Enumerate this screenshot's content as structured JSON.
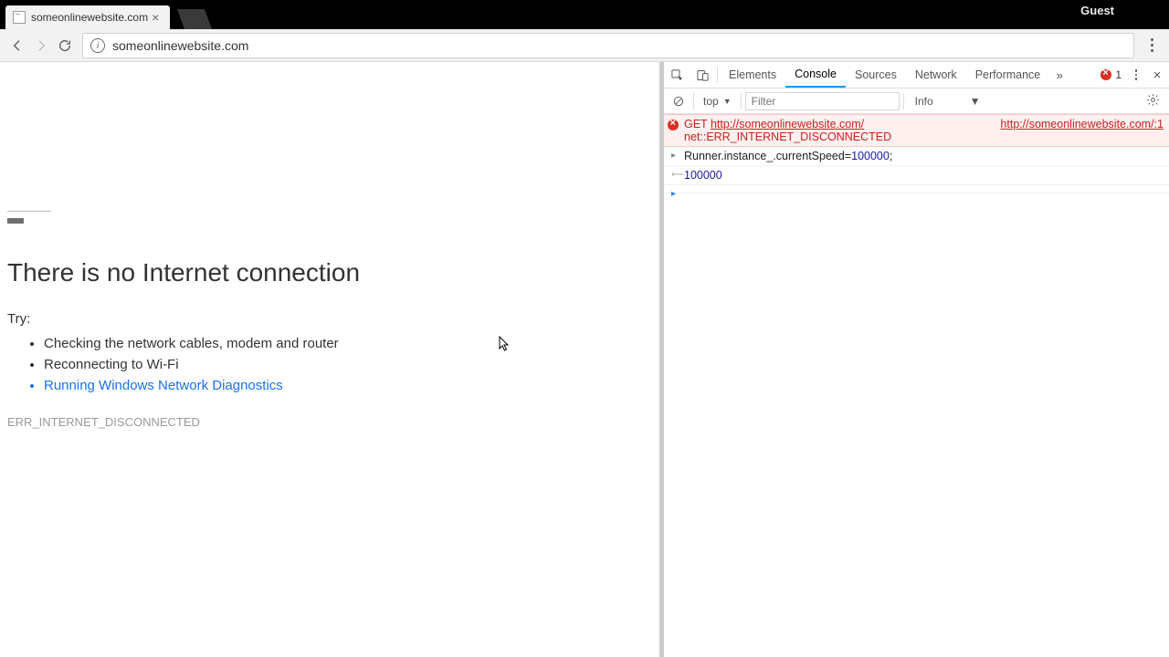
{
  "chrome": {
    "tab_title": "someonlinewebsite.com",
    "guest_label": "Guest",
    "url": "someonlinewebsite.com"
  },
  "error_page": {
    "heading": "There is no Internet connection",
    "try_label": "Try:",
    "tips": {
      "t0": "Checking the network cables, modem and router",
      "t1": "Reconnecting to Wi-Fi",
      "t2": "Running Windows Network Diagnostics"
    },
    "error_code": "ERR_INTERNET_DISCONNECTED"
  },
  "devtools": {
    "tabs": {
      "elements": "Elements",
      "console": "Console",
      "sources": "Sources",
      "network": "Network",
      "performance": "Performance"
    },
    "error_count": "1",
    "toolbar": {
      "context": "top",
      "filter_placeholder": "Filter",
      "level": "Info"
    },
    "console": {
      "error": {
        "method": "GET",
        "url": "http://someonlinewebsite.com/",
        "source": "http://someonlinewebsite.com/:1",
        "detail": "net::ERR_INTERNET_DISCONNECTED"
      },
      "input_prefix": "Runner.instance_.currentSpeed=",
      "input_value": "100000",
      "input_suffix": ";",
      "result": "100000"
    }
  }
}
